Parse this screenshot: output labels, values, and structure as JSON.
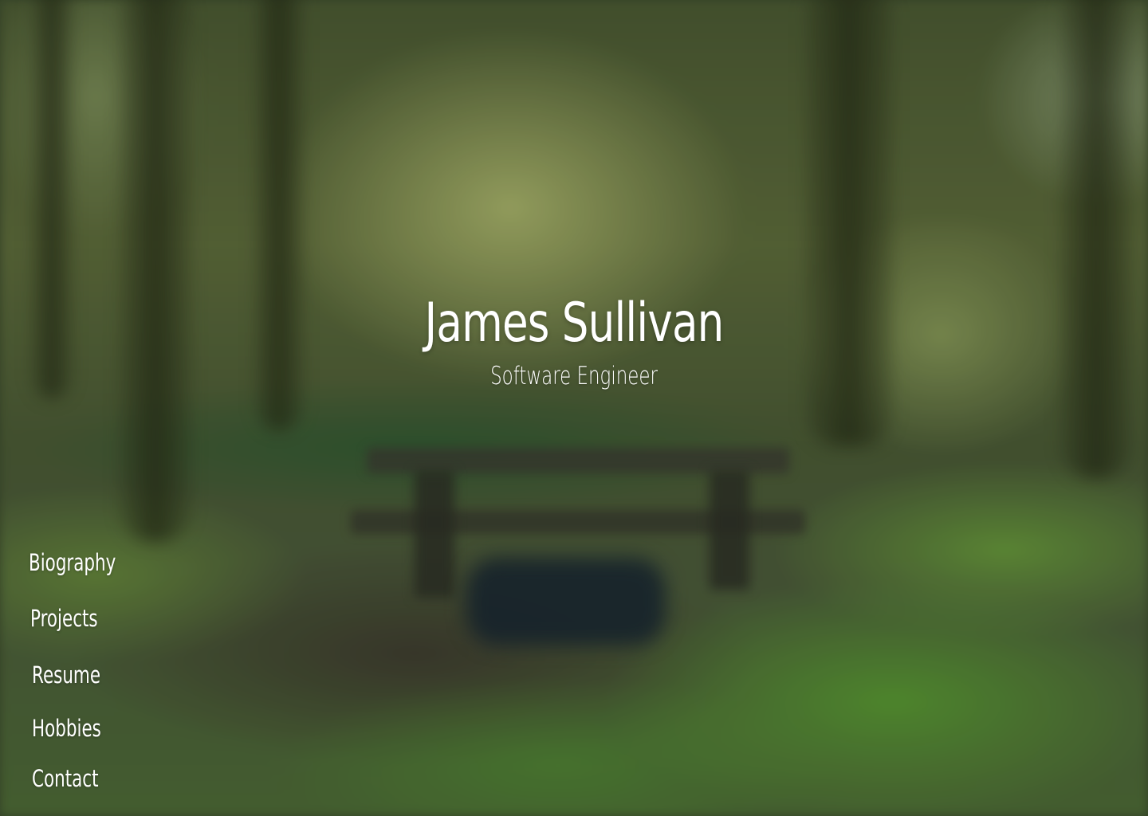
{
  "hero": {
    "name": "James Sullivan",
    "role": "Software Engineer"
  },
  "nav": {
    "items": [
      {
        "label": "Biography"
      },
      {
        "label": "Projects"
      },
      {
        "label": "Resume"
      },
      {
        "label": "Hobbies"
      },
      {
        "label": "Contact"
      }
    ]
  },
  "colors": {
    "text": "#ffffff",
    "forest_dark": "#3a4a2c",
    "grass": "#5aa032"
  }
}
